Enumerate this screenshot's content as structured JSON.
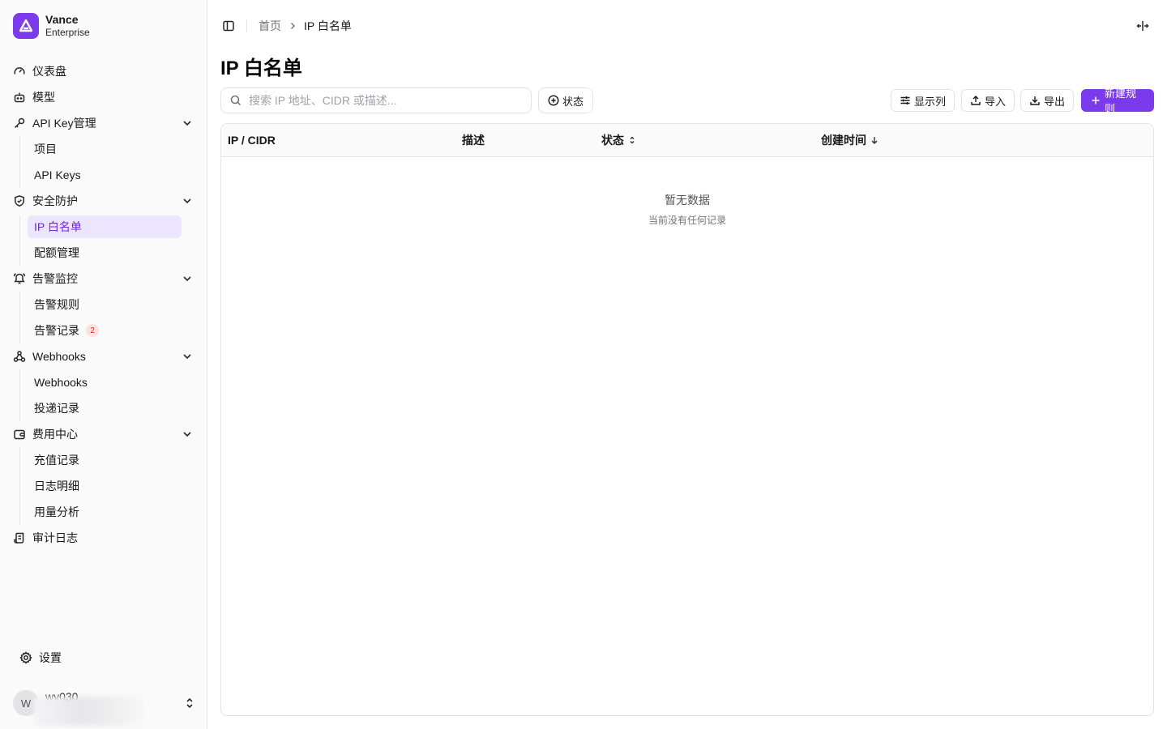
{
  "brand": {
    "name": "Vance",
    "sub": "Enterprise"
  },
  "sidebar": {
    "items": [
      {
        "label": "仪表盘",
        "icon": "dashboard-gauge-icon"
      },
      {
        "label": "模型",
        "icon": "bot-icon"
      },
      {
        "label": "API Key管理",
        "icon": "key-icon",
        "expanded": true,
        "children": [
          {
            "label": "项目"
          },
          {
            "label": "API Keys"
          }
        ]
      },
      {
        "label": "安全防护",
        "icon": "shield-check-icon",
        "expanded": true,
        "children": [
          {
            "label": "IP 白名单",
            "active": true
          },
          {
            "label": "配额管理"
          }
        ]
      },
      {
        "label": "告警监控",
        "icon": "bell-ring-icon",
        "expanded": true,
        "children": [
          {
            "label": "告警规则"
          },
          {
            "label": "告警记录",
            "badge": "2"
          }
        ]
      },
      {
        "label": "Webhooks",
        "icon": "webhook-icon",
        "expanded": true,
        "children": [
          {
            "label": "Webhooks"
          },
          {
            "label": "投递记录"
          }
        ]
      },
      {
        "label": "费用中心",
        "icon": "wallet-icon",
        "expanded": true,
        "children": [
          {
            "label": "充值记录"
          },
          {
            "label": "日志明细"
          },
          {
            "label": "用量分析"
          }
        ]
      },
      {
        "label": "审计日志",
        "icon": "scroll-text-icon"
      }
    ],
    "settings_label": "设置",
    "user": {
      "avatar_initial": "W",
      "name": "wy030"
    }
  },
  "breadcrumb": {
    "home": "首页",
    "current": "IP 白名单"
  },
  "page": {
    "title": "IP 白名单"
  },
  "toolbar": {
    "search_placeholder": "搜索 IP 地址、CIDR 或描述...",
    "status_filter": "状态",
    "columns_label": "显示列",
    "import_label": "导入",
    "export_label": "导出",
    "new_rule_label": "新建规则"
  },
  "table": {
    "columns": [
      {
        "label": "IP / CIDR"
      },
      {
        "label": "描述"
      },
      {
        "label": "状态",
        "sort": "both"
      },
      {
        "label": "创建时间",
        "sort": "desc"
      }
    ],
    "empty_title": "暂无数据",
    "empty_sub": "当前没有任何记录"
  },
  "colors": {
    "accent": "#7c3aed",
    "active_bg": "#ede4fd",
    "badge": "#dc2626"
  }
}
